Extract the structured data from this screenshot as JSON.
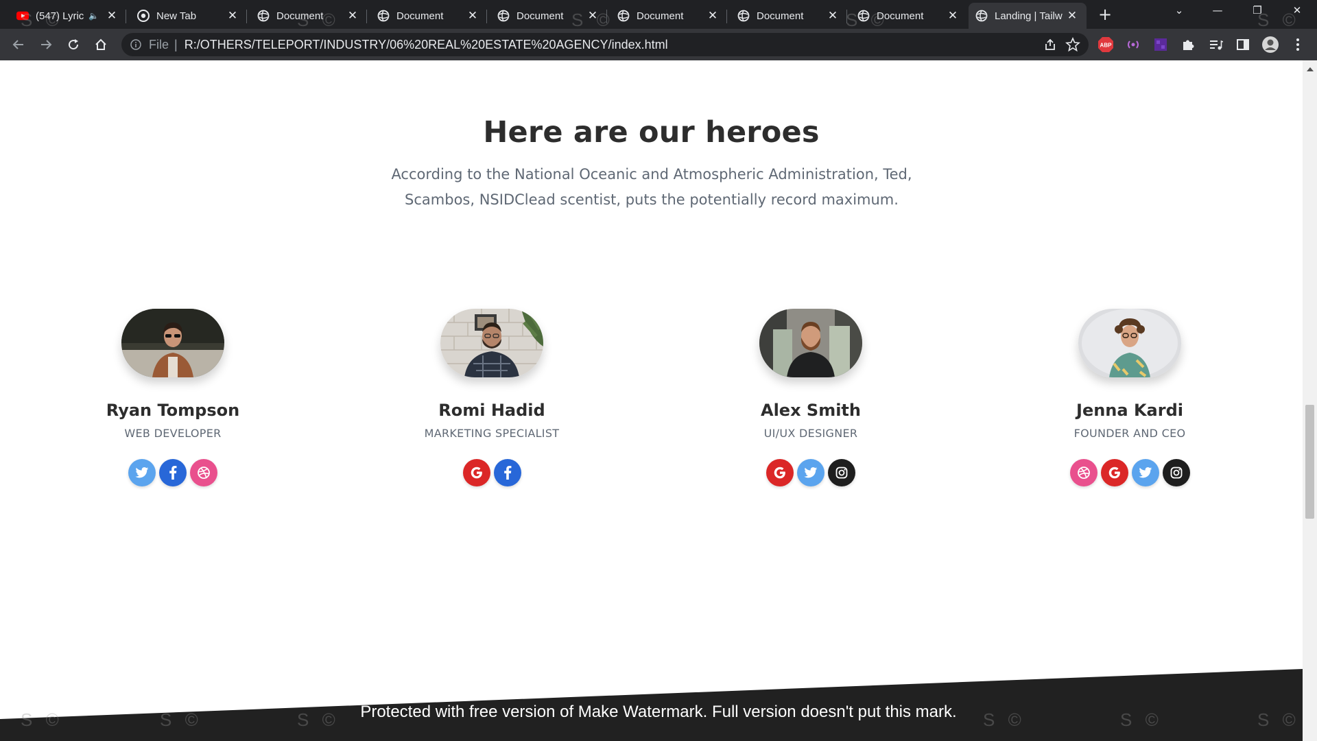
{
  "browser": {
    "tabs": [
      {
        "title": "(547) Lyric",
        "icon": "youtube-icon",
        "audio": true
      },
      {
        "title": "New Tab",
        "icon": "chrome-icon"
      },
      {
        "title": "Document",
        "icon": "globe-icon"
      },
      {
        "title": "Document",
        "icon": "globe-icon"
      },
      {
        "title": "Document",
        "icon": "globe-icon"
      },
      {
        "title": "Document",
        "icon": "globe-icon"
      },
      {
        "title": "Document",
        "icon": "globe-icon"
      },
      {
        "title": "Document",
        "icon": "globe-icon"
      },
      {
        "title": "Landing | Tailw",
        "icon": "globe-icon",
        "active": true
      }
    ],
    "address": {
      "scheme": "File",
      "url": "R:/OTHERS/TELEPORT/INDUSTRY/06%20REAL%20ESTATE%20AGENCY/index.html"
    },
    "extensions": {
      "abp_label": "ABP"
    }
  },
  "page": {
    "heading": "Here are our heroes",
    "subtext": "According to the National Oceanic and Atmospheric Administration, Ted, Scambos, NSIDClead scentist, puts the potentially record maximum.",
    "team": [
      {
        "name": "Ryan Tompson",
        "role": "WEB DEVELOPER",
        "socials": [
          "twitter",
          "facebook",
          "dribbble"
        ]
      },
      {
        "name": "Romi Hadid",
        "role": "MARKETING SPECIALIST",
        "socials": [
          "google",
          "facebook"
        ]
      },
      {
        "name": "Alex Smith",
        "role": "UI/UX DESIGNER",
        "socials": [
          "google",
          "twitter",
          "instagram"
        ]
      },
      {
        "name": "Jenna Kardi",
        "role": "FOUNDER AND CEO",
        "socials": [
          "dribbble",
          "google",
          "twitter",
          "instagram"
        ]
      }
    ]
  },
  "watermark": {
    "text": "Protected with free version of Make Watermark. Full version doesn't put this mark.",
    "mark": "S ©"
  },
  "colors": {
    "twitter": "#5ba4ee",
    "facebook": "#2867d8",
    "dribbble": "#e9508d",
    "google": "#db2727",
    "instagram": "#1e1e1e",
    "footer": "#212121"
  }
}
